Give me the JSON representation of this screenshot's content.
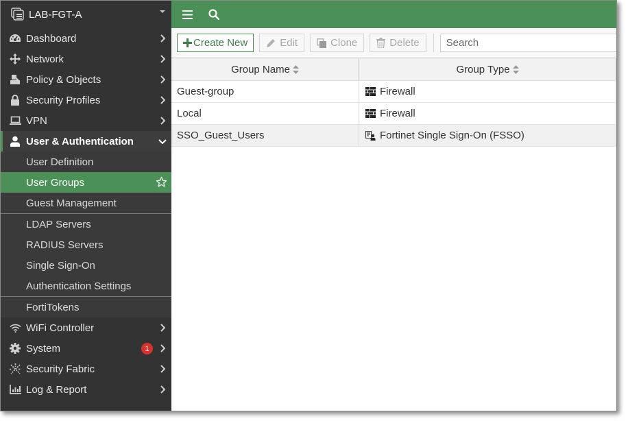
{
  "device": {
    "name": "LAB-FGT-A"
  },
  "sidebar": {
    "items": [
      {
        "label": "Dashboard",
        "icon": "dashboard-icon"
      },
      {
        "label": "Network",
        "icon": "network-move-icon"
      },
      {
        "label": "Policy & Objects",
        "icon": "policy-icon"
      },
      {
        "label": "Security Profiles",
        "icon": "lock-icon"
      },
      {
        "label": "VPN",
        "icon": "laptop-icon"
      },
      {
        "label": "User & Authentication",
        "icon": "user-icon",
        "expanded": true
      },
      {
        "label": "WiFi Controller",
        "icon": "wifi-icon"
      },
      {
        "label": "System",
        "icon": "gear-icon",
        "badge": "1"
      },
      {
        "label": "Security Fabric",
        "icon": "fabric-icon"
      },
      {
        "label": "Log & Report",
        "icon": "chart-icon"
      }
    ],
    "subitems": [
      {
        "label": "User Definition"
      },
      {
        "label": "User Groups",
        "selected": true
      },
      {
        "label": "Guest Management"
      },
      {
        "label": "LDAP Servers"
      },
      {
        "label": "RADIUS Servers"
      },
      {
        "label": "Single Sign-On"
      },
      {
        "label": "Authentication Settings"
      },
      {
        "label": "FortiTokens"
      }
    ]
  },
  "topbar": {
    "menu_icon": "hamburger-icon",
    "search_icon": "search-icon"
  },
  "toolbar": {
    "create_new": "Create New",
    "edit": "Edit",
    "clone": "Clone",
    "delete": "Delete",
    "search_placeholder": "Search"
  },
  "table": {
    "columns": [
      "Group Name",
      "Group Type"
    ],
    "rows": [
      {
        "name": "Guest-group",
        "type": "Firewall",
        "type_icon": "firewall-icon"
      },
      {
        "name": "Local",
        "type": "Firewall",
        "type_icon": "firewall-icon"
      },
      {
        "name": "SSO_Guest_Users",
        "type": "Fortinet Single Sign-On (FSSO)",
        "type_icon": "fsso-icon"
      }
    ]
  },
  "colors": {
    "accent": "#4a9057",
    "sidebar_bg": "#333333",
    "badge": "#d9322a"
  }
}
